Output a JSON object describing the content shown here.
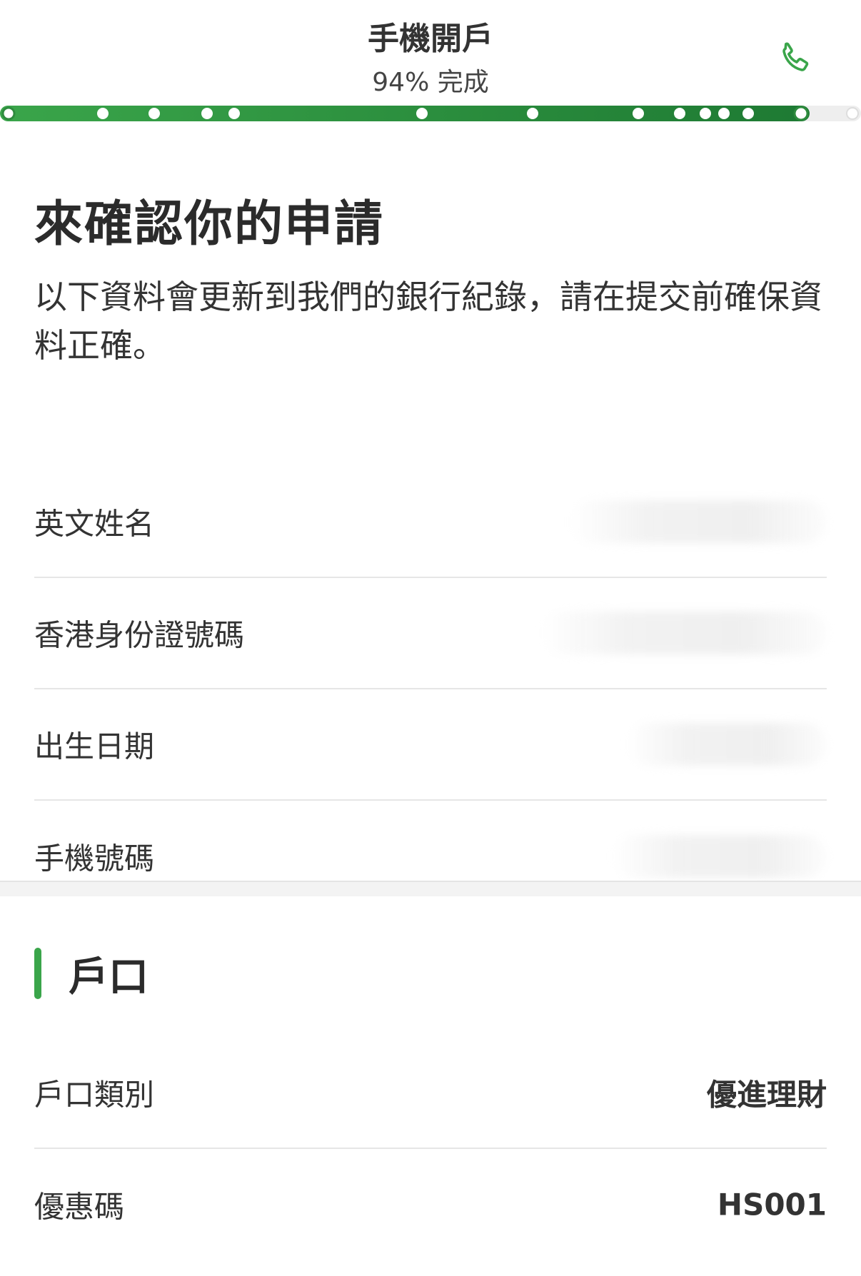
{
  "header": {
    "title": "手機開戶",
    "progress_text": "94% 完成",
    "progress_fraction": 0.94,
    "phone_icon": "phone-icon",
    "accent_color": "#2e8b3e"
  },
  "page": {
    "title": "來確認你的申請",
    "description": "以下資料會更新到我們的銀行紀錄，請在提交前確保資料正確。"
  },
  "personal_fields": [
    {
      "label": "英文姓名"
    },
    {
      "label": "香港身份證號碼"
    },
    {
      "label": "出生日期"
    },
    {
      "label": "手機號碼"
    }
  ],
  "account_section": {
    "title": "戶口",
    "rows": [
      {
        "label": "戶口類別",
        "value": "優進理財"
      },
      {
        "label": "優惠碼",
        "value": "HS001"
      }
    ]
  }
}
